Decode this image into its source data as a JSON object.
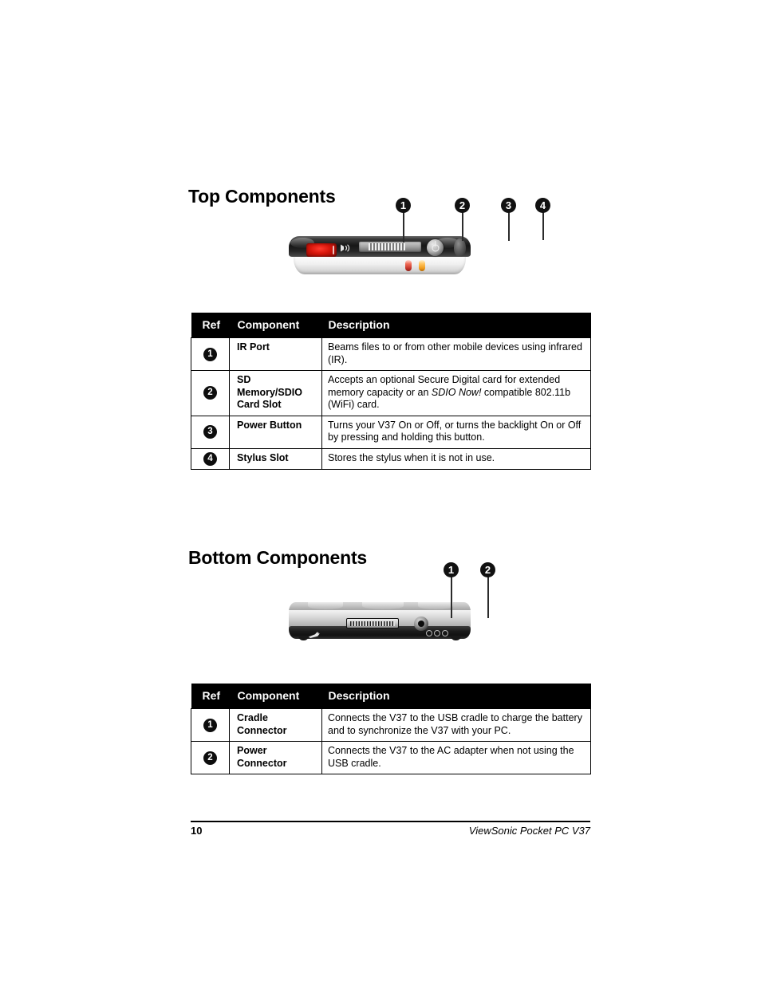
{
  "sections": [
    {
      "heading": "Top Components",
      "figure_callouts": [
        "1",
        "2",
        "3",
        "4"
      ],
      "table": {
        "columns": [
          "Ref",
          "Component",
          "Description"
        ],
        "rows": [
          {
            "ref": "1",
            "component": "IR Port",
            "description": "Beams files to or from other mobile devices using infrared (IR)."
          },
          {
            "ref": "2",
            "component": "SD Memory/SDIO Card Slot",
            "desc_part1": "Accepts an optional Secure Digital card for extended memory capacity or an ",
            "desc_italic": "SDIO Now!",
            "desc_part2": " compatible 802.11b (WiFi) card."
          },
          {
            "ref": "3",
            "component": "Power Button",
            "description": "Turns your V37 On or Off, or turns the backlight On or Off by pressing and holding this button."
          },
          {
            "ref": "4",
            "component": "Stylus Slot",
            "description": "Stores the stylus when it is not in use."
          }
        ]
      }
    },
    {
      "heading": "Bottom Components",
      "figure_callouts": [
        "1",
        "2"
      ],
      "table": {
        "columns": [
          "Ref",
          "Component",
          "Description"
        ],
        "rows": [
          {
            "ref": "1",
            "component": "Cradle Connector",
            "description": "Connects the V37 to the USB cradle to charge the battery and to synchronize the V37 with your PC."
          },
          {
            "ref": "2",
            "component": "Power Connector",
            "description": "Connects the V37 to the AC adapter when not using the USB cradle."
          }
        ]
      }
    }
  ],
  "footer": {
    "page_number": "10",
    "product": "ViewSonic  Pocket PC  V37"
  },
  "colors": {
    "header_background": "#000000",
    "header_text": "#ffffff",
    "body_text": "#000000",
    "page_background": "#ffffff",
    "ir_window": "#d8160b",
    "led_red": "#c4342a",
    "led_amber": "#ef9a1b"
  }
}
